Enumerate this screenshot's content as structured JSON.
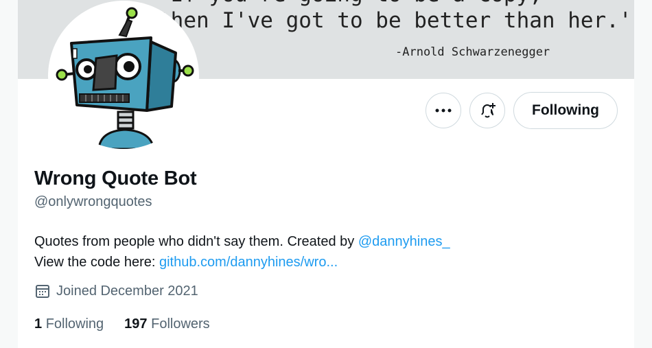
{
  "banner": {
    "quote_line1": "\"If you're going to be a copy,",
    "quote_line2": "then I've got to be better than her.'\"",
    "attribution": "-Arnold Schwarzenegger"
  },
  "actions": {
    "more_icon": "more-icon",
    "notify_icon": "bell-plus-icon",
    "following_label": "Following"
  },
  "profile": {
    "name": "Wrong Quote Bot",
    "handle": "@onlywrongquotes",
    "bio_text": "Quotes from people who didn't say them. Created by ",
    "bio_mention": "@dannyhines_",
    "bio_line2_text": "View the code here: ",
    "bio_link": "github.com/dannyhines/wro...",
    "joined": "Joined December 2021",
    "calendar_icon": "calendar-icon"
  },
  "stats": {
    "following_count": "1",
    "following_label": "Following",
    "followers_count": "197",
    "followers_label": "Followers"
  },
  "colors": {
    "link": "#1d9bf0",
    "banner_bg": "#dfe2e3",
    "robot_body": "#4aa3c0",
    "robot_accent": "#9be04a"
  }
}
